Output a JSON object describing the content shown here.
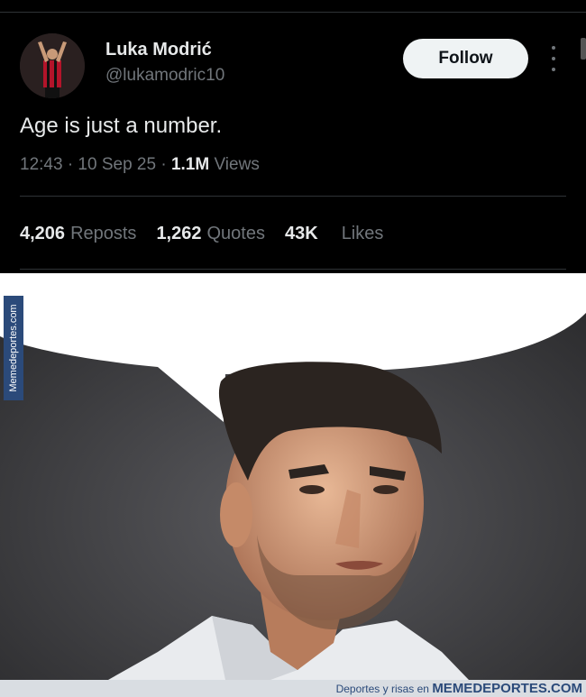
{
  "tweet": {
    "author_name": "Luka Modrić",
    "author_handle": "@lukamodric10",
    "follow_label": "Follow",
    "text": "Age is just a number.",
    "time": "12:43 · 10 Sep 25 · ",
    "views_count": "1.1M",
    "views_label": " Views",
    "stats": {
      "reposts_count": "4,206",
      "reposts_label": "Reposts",
      "quotes_count": "1,262",
      "quotes_label": "Quotes",
      "likes_count": "43K",
      "likes_label": "Likes"
    }
  },
  "watermark": {
    "vertical_text": "Memedeportes.com",
    "footer_prefix": "Deportes y risas en ",
    "footer_brand": "MEMEDEPORTES.COM"
  },
  "colors": {
    "background": "#000000",
    "text_primary": "#e7e9ea",
    "text_secondary": "#71767b",
    "follow_bg": "#eff3f4",
    "brand_blue": "#2b4a7a"
  },
  "icons": {
    "more": "more-vertical-icon"
  }
}
